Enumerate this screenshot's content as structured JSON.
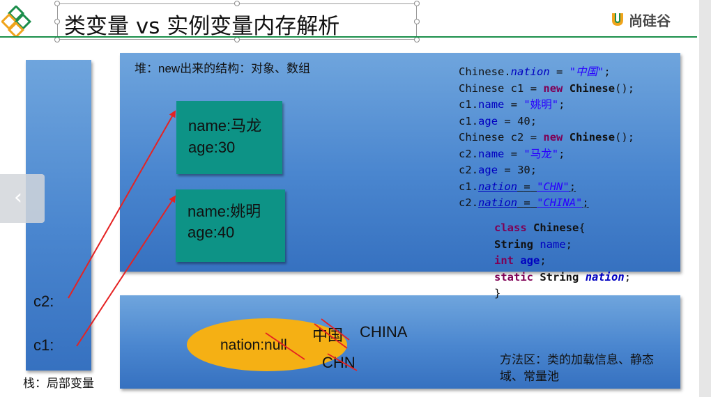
{
  "header": {
    "title": "类变量 vs 实例变量内存解析",
    "brand": "尚硅谷"
  },
  "stack": {
    "label": "栈：局部变量",
    "c2": "c2:",
    "c1": "c1:"
  },
  "heap": {
    "label": "堆：new出来的结构：对象、数组",
    "objects": [
      {
        "name": "name:马龙",
        "age": "age:30"
      },
      {
        "name": "name:姚明",
        "age": "age:40"
      }
    ]
  },
  "method_area": {
    "label": "方法区：类的加载信息、静态域、常量池",
    "nation_null": "nation:null",
    "values": [
      "中国",
      "CHINA",
      "CHN"
    ]
  },
  "code": {
    "lines": [
      "Chinese.nation = \"中国\";",
      "Chinese c1 = new Chinese();",
      "c1.name = \"姚明\";",
      "c1.age = 40;",
      "Chinese c2 = new Chinese();",
      "c2.name = \"马龙\";",
      "c2.age = 30;",
      "c1.nation = \"CHN\";",
      "c2.nation = \"CHINA\";"
    ],
    "class_lines": [
      "class Chinese{",
      "String name;",
      "int age;",
      "static String nation;",
      "}"
    ]
  },
  "colors": {
    "panel": "#4a86cf",
    "object": "#0d9386",
    "oval": "#f5b014",
    "arrow": "#e52222",
    "rule": "#1a8f4a"
  },
  "icons": [
    "diamond-logo-icon",
    "brand-logo-icon",
    "chevron-left-icon"
  ]
}
